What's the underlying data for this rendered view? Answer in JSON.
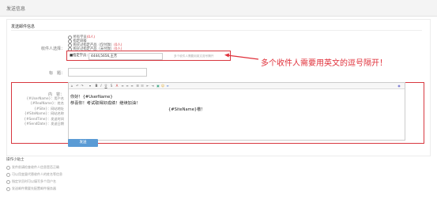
{
  "page": {
    "title": "发送信息"
  },
  "section": {
    "title": "发送邮件信息"
  },
  "recipients": {
    "label": "收件人选择：",
    "options": [
      {
        "text": "所有学员",
        "suffix": "(0人)",
        "selected": false
      },
      {
        "text": "指定班级",
        "suffix": "",
        "selected": false
      },
      {
        "text": "购买过指定产品（仅付款）",
        "suffix": "(0人)",
        "selected": false
      },
      {
        "text": "购买过指定产品（未付款）",
        "suffix": "(0人)",
        "selected": false
      },
      {
        "text": "指定学员",
        "suffix": "",
        "selected": true
      }
    ],
    "selected_prefix": "■指定学员：",
    "input_value": "4444,5656,王芳",
    "input_hint": "多个收件人需要用英文逗号隔开"
  },
  "callout": {
    "text": "多个收件人需要用英文的逗号隔开！"
  },
  "subject": {
    "label": "标　题：",
    "value": ""
  },
  "content": {
    "label": "内　容：",
    "variables": [
      "{#UserName}：用户名",
      "{#RealName}：姓名",
      "{#Site}：网站地址",
      "{#SiteName}：网站名称",
      "{#SendTime}：发送时间",
      "{#SendDate}：发送日期"
    ],
    "editor_lines": [
      "你好！{#UserName}",
      "恭喜你！考试取得好成绩！继续加油！",
      "{#SiteName}敬！"
    ]
  },
  "submit": {
    "label": "发送"
  },
  "footer": {
    "title": "操作小贴士",
    "tips": [
      "发件前请检查收件人信息是否正确",
      "可以用变量代替收件人的姓名等信息",
      "指定学员时可以填写多个用户名",
      "发送邮件需要先配置邮件服务器"
    ]
  },
  "colors": {
    "accent": "#d8373f",
    "button": "#5a9bd5"
  }
}
